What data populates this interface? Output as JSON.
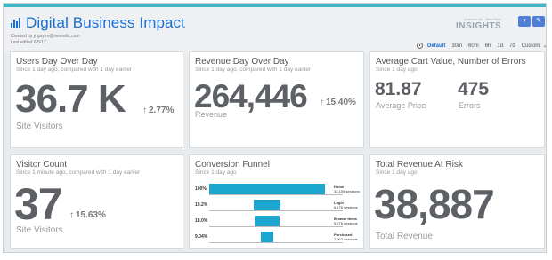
{
  "header": {
    "title": "Digital Business Impact",
    "created_by": "Created by jnguyen@newrelic.com",
    "last_edited": "Last edited 6/5/17",
    "brand_small": "New Relic",
    "brand_big": "INSIGHTS",
    "brand_prefix": "powered by",
    "time_options": [
      "Default",
      "30m",
      "60m",
      "6h",
      "1d",
      "7d",
      "Custom"
    ],
    "active_time": "Default"
  },
  "cards": {
    "users": {
      "title": "Users Day Over Day",
      "subtitle": "Since 1 day ago, compared with 1 day earlier",
      "value": "36.7 K",
      "delta": "2.77%",
      "label": "Site Visitors"
    },
    "revenue": {
      "title": "Revenue Day Over Day",
      "subtitle": "Since 1 day ago, compared with 1 day earlier",
      "value": "264,446",
      "delta": "15.40%",
      "label": "Revenue"
    },
    "avgcart": {
      "title": "Average Cart Value, Number of Errors",
      "subtitle": "Since 1 day ago",
      "value1": "81.87",
      "label1": "Average Price",
      "value2": "475",
      "label2": "Errors"
    },
    "visitors": {
      "title": "Visitor Count",
      "subtitle": "Since 1 minute ago, compared with 1 day earlier",
      "value": "37",
      "delta": "15.63%",
      "label": "Site Visitors"
    },
    "funnel": {
      "title": "Conversion Funnel",
      "subtitle": "Since 1 day ago",
      "steps": [
        {
          "pct": "100%",
          "name": "Home",
          "sessions": "32,109 sessions",
          "fraction": 1.0
        },
        {
          "pct": "19.2%",
          "name": "Login",
          "sessions": "6,176 sessions",
          "fraction": 0.192
        },
        {
          "pct": "18.0%",
          "name": "Browse Items",
          "sessions": "5,776 sessions",
          "fraction": 0.18
        },
        {
          "pct": "9.04%",
          "name": "Purchased",
          "sessions": "2,902 sessions",
          "fraction": 0.0904
        }
      ]
    },
    "risk": {
      "title": "Total Revenue At Risk",
      "subtitle": "Since 1 day ago",
      "value": "38,887",
      "label": "Total Revenue"
    }
  },
  "colors": {
    "accent": "#1a6fd0",
    "funnel_bar": "#1aa6cf",
    "top_strip": "#45b6c4"
  }
}
